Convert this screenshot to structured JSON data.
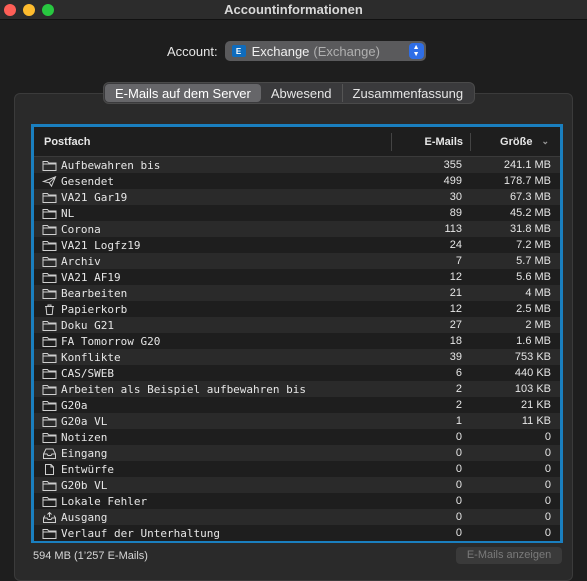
{
  "window": {
    "title": "Accountinformationen"
  },
  "account": {
    "label": "Account:",
    "name": "Exchange",
    "type": "(Exchange)"
  },
  "tabs": [
    {
      "label": "E-Mails auf dem Server",
      "active": true
    },
    {
      "label": "Abwesend",
      "active": false
    },
    {
      "label": "Zusammenfassung",
      "active": false
    }
  ],
  "table": {
    "headers": {
      "mailbox": "Postfach",
      "mails": "E-Mails",
      "size": "Größe"
    },
    "rows": [
      {
        "icon": "folder-icon",
        "name": "Aufbewahren bis",
        "mails": "355",
        "size": "241.1 MB"
      },
      {
        "icon": "paper-plane-icon",
        "name": "Gesendet",
        "mails": "499",
        "size": "178.7 MB"
      },
      {
        "icon": "folder-icon",
        "name": "VA21 Gar19",
        "mails": "30",
        "size": "67.3 MB"
      },
      {
        "icon": "folder-icon",
        "name": "NL",
        "mails": "89",
        "size": "45.2 MB"
      },
      {
        "icon": "folder-icon",
        "name": "Corona",
        "mails": "113",
        "size": "31.8 MB"
      },
      {
        "icon": "folder-icon",
        "name": "VA21 Logfz19",
        "mails": "24",
        "size": "7.2 MB"
      },
      {
        "icon": "folder-icon",
        "name": "Archiv",
        "mails": "7",
        "size": "5.7 MB"
      },
      {
        "icon": "folder-icon",
        "name": "VA21 AF19",
        "mails": "12",
        "size": "5.6 MB"
      },
      {
        "icon": "folder-icon",
        "name": "Bearbeiten",
        "mails": "21",
        "size": "4 MB"
      },
      {
        "icon": "trash-icon",
        "name": "Papierkorb",
        "mails": "12",
        "size": "2.5 MB"
      },
      {
        "icon": "folder-icon",
        "name": "Doku G21",
        "mails": "27",
        "size": "2 MB"
      },
      {
        "icon": "folder-icon",
        "name": "FA Tomorrow G20",
        "mails": "18",
        "size": "1.6 MB"
      },
      {
        "icon": "folder-icon",
        "name": "Konflikte",
        "mails": "39",
        "size": "753 KB"
      },
      {
        "icon": "folder-icon",
        "name": "CAS/SWEB",
        "mails": "6",
        "size": "440 KB"
      },
      {
        "icon": "folder-icon",
        "name": "Arbeiten als Beispiel aufbewahren bis",
        "mails": "2",
        "size": "103 KB"
      },
      {
        "icon": "folder-icon",
        "name": "G20a",
        "mails": "2",
        "size": "21 KB"
      },
      {
        "icon": "folder-icon",
        "name": "G20a VL",
        "mails": "1",
        "size": "11 KB"
      },
      {
        "icon": "folder-icon",
        "name": "Notizen",
        "mails": "0",
        "size": "0"
      },
      {
        "icon": "inbox-icon",
        "name": "Eingang",
        "mails": "0",
        "size": "0"
      },
      {
        "icon": "document-icon",
        "name": "Entwürfe",
        "mails": "0",
        "size": "0"
      },
      {
        "icon": "folder-icon",
        "name": "G20b VL",
        "mails": "0",
        "size": "0"
      },
      {
        "icon": "folder-icon",
        "name": "Lokale Fehler",
        "mails": "0",
        "size": "0"
      },
      {
        "icon": "outbox-icon",
        "name": "Ausgang",
        "mails": "0",
        "size": "0"
      },
      {
        "icon": "folder-icon",
        "name": "Verlauf der Unterhaltung",
        "mails": "0",
        "size": "0"
      }
    ]
  },
  "footer": {
    "summary": "594 MB (1’257 E-Mails)",
    "show_button": "E-Mails anzeigen"
  },
  "colors": {
    "accent": "#1a7fbf",
    "select_button": "#2f6ee6",
    "exchange_blue": "#0f6cbd"
  }
}
